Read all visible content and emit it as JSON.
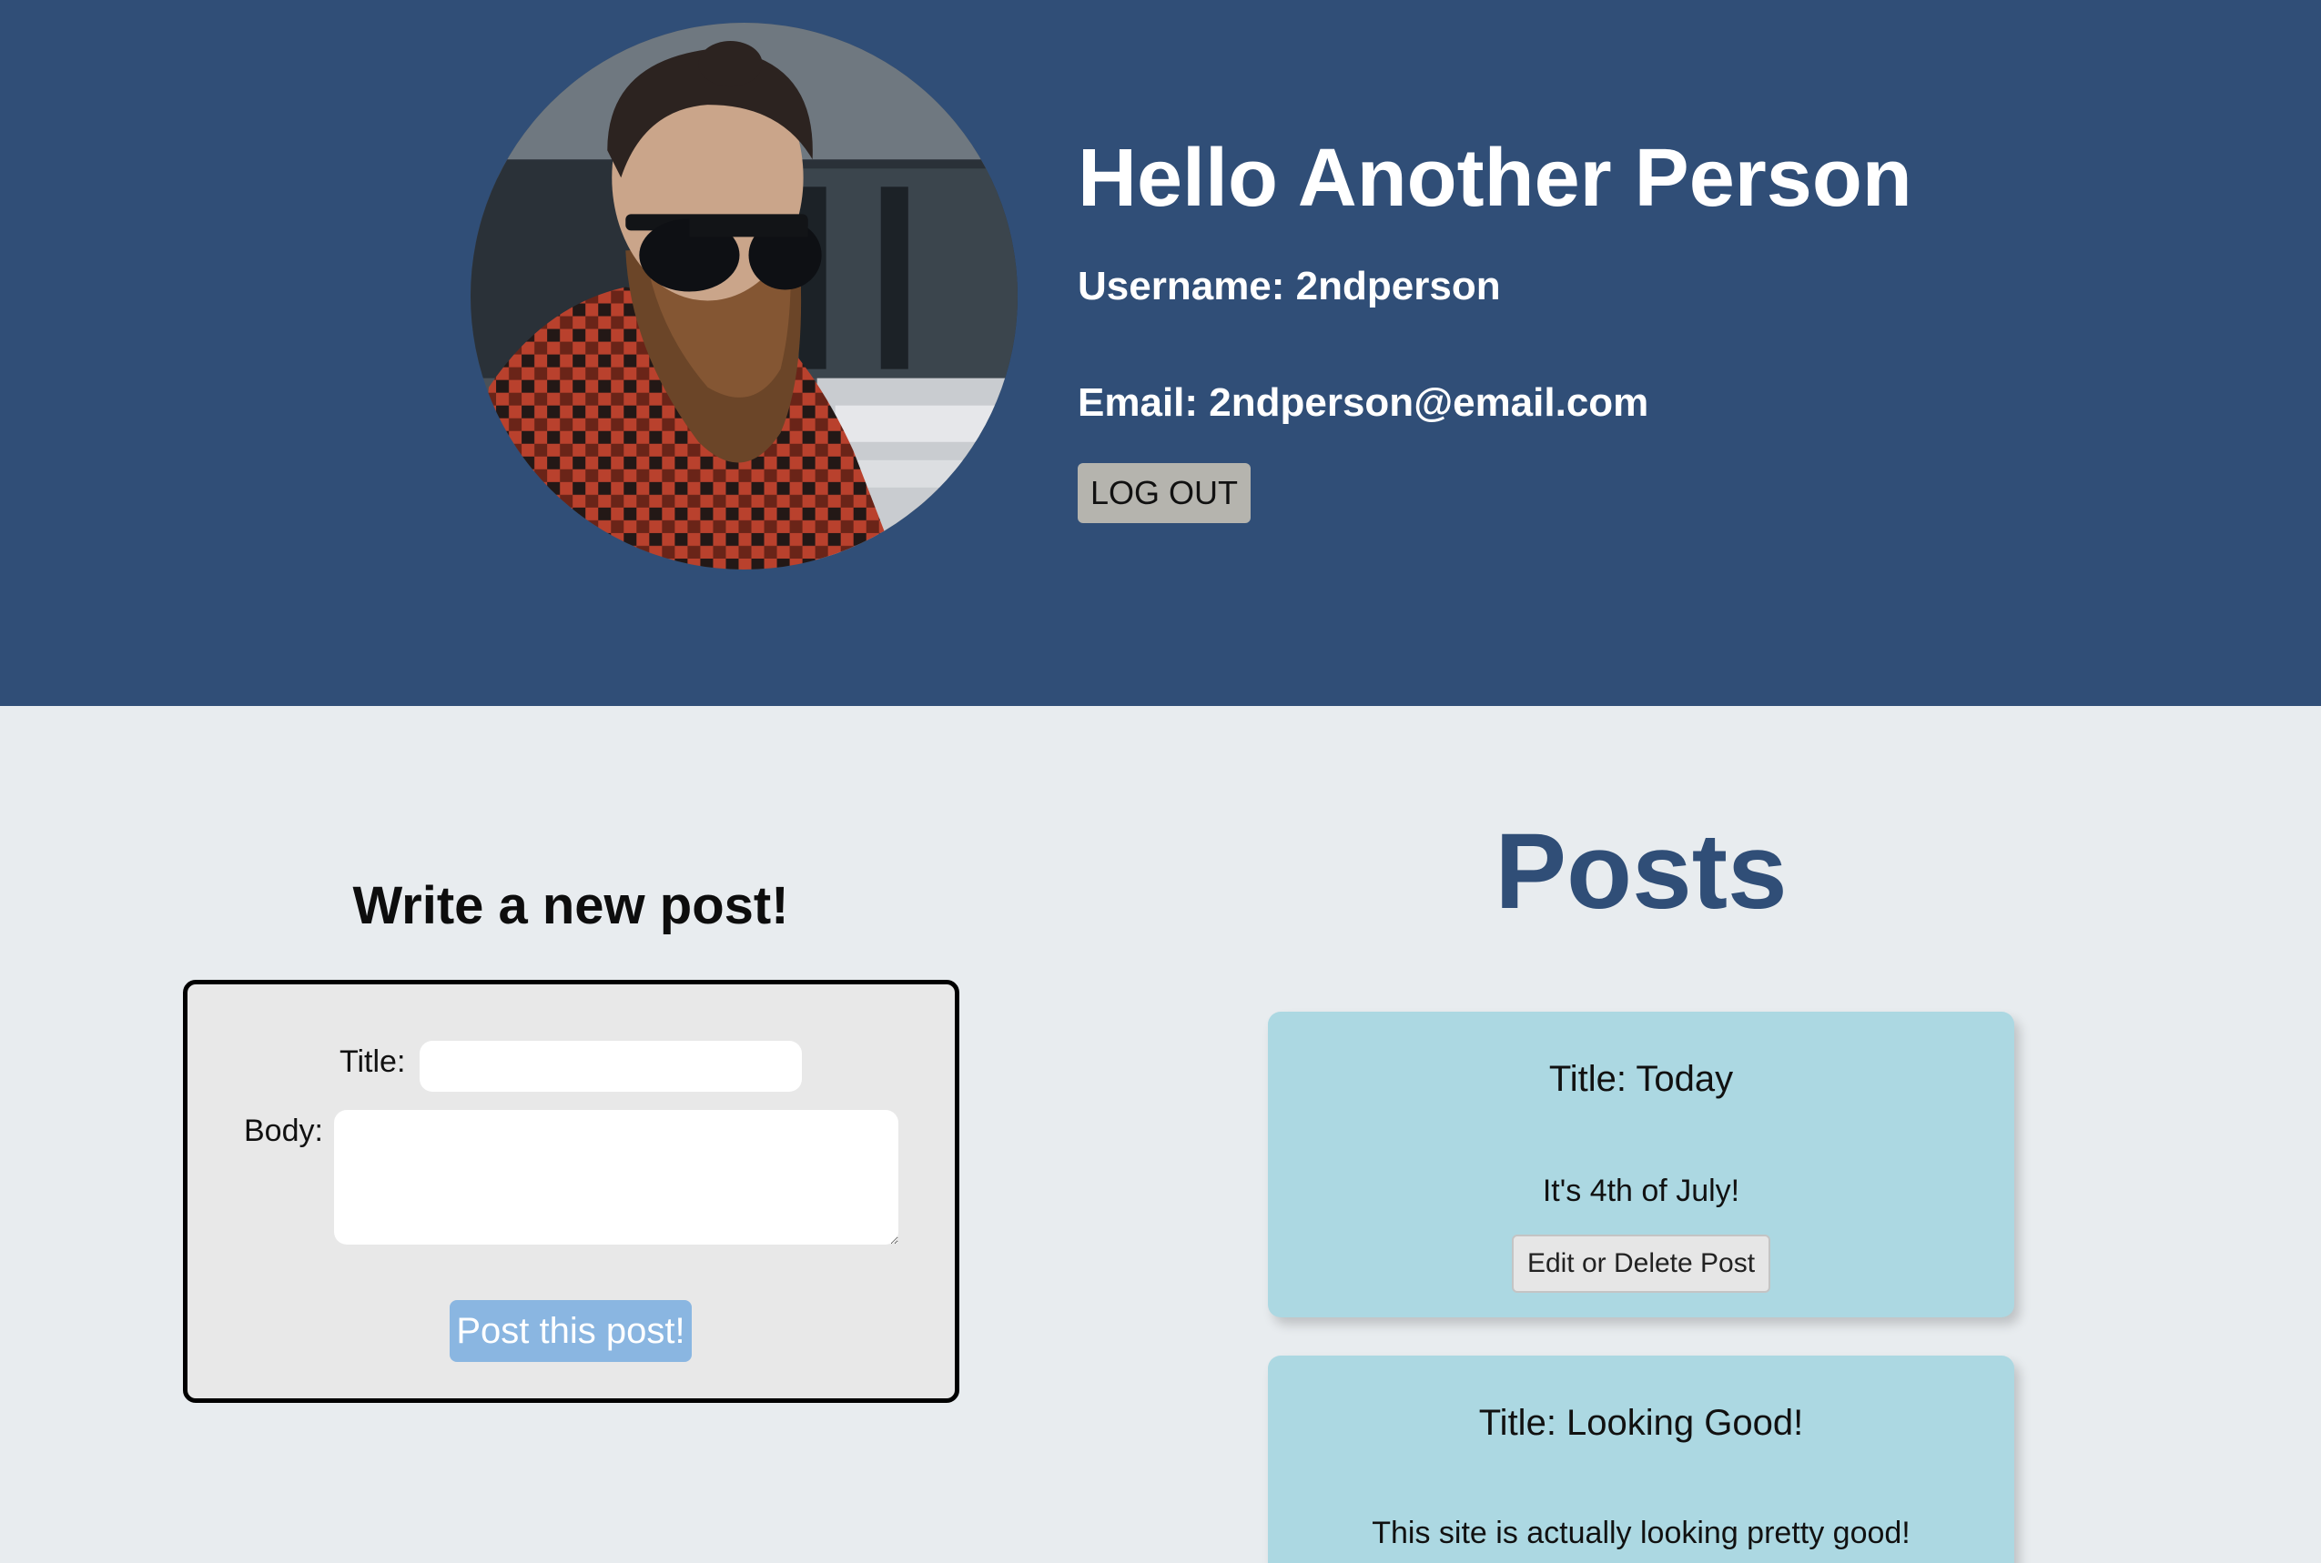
{
  "profile": {
    "greeting": "Hello Another Person",
    "username_line": "Username: 2ndperson",
    "email_line": "Email: 2ndperson@email.com",
    "logout_label": "LOG OUT",
    "avatar_alt": "profile-photo"
  },
  "new_post": {
    "heading": "Write a new post!",
    "title_label": "Title:",
    "body_label": "Body:",
    "title_value": "",
    "body_value": "",
    "submit_label": "Post this post!"
  },
  "posts": {
    "heading": "Posts",
    "items": [
      {
        "title": "Title: Today",
        "body": "It's 4th of July!",
        "edit_label": "Edit or Delete Post"
      },
      {
        "title": "Title: Looking Good!",
        "body": "This site is actually looking pretty good!"
      }
    ]
  },
  "colors": {
    "header_bg": "#304e77",
    "page_bg": "#e8ecef",
    "card_bg": "#acd8e2",
    "post_button": "#8ab6e1",
    "logout_button": "#b5b4ae"
  }
}
